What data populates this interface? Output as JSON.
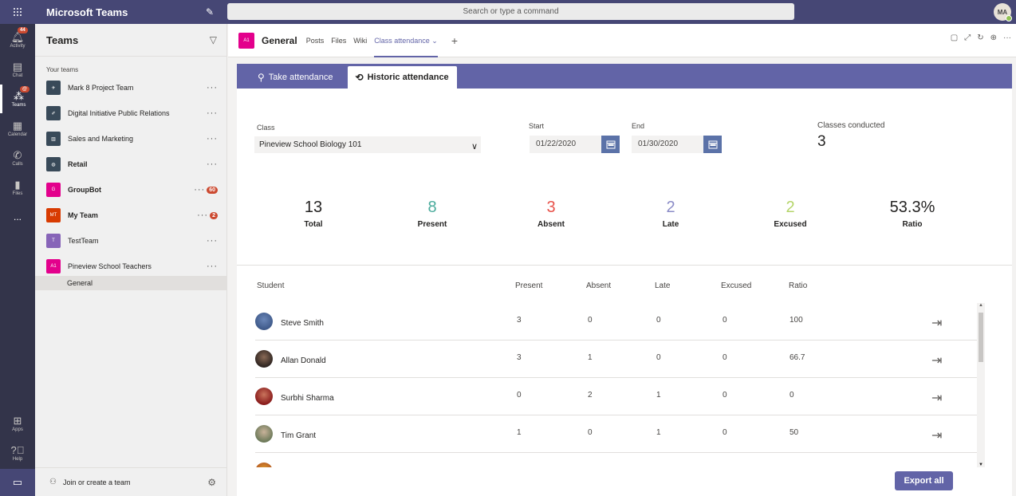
{
  "app": {
    "title": "Microsoft Teams",
    "search_placeholder": "Search or type a command",
    "user_initials": "MA"
  },
  "rail": [
    {
      "label": "Activity",
      "badge": "44"
    },
    {
      "label": "Chat",
      "badge": ""
    },
    {
      "label": "Teams",
      "badge": "@"
    },
    {
      "label": "Calendar",
      "badge": ""
    },
    {
      "label": "Calls",
      "badge": ""
    },
    {
      "label": "Files",
      "badge": ""
    },
    {
      "label": "...",
      "badge": ""
    },
    {
      "label": "Apps",
      "badge": ""
    },
    {
      "label": "Help",
      "badge": ""
    }
  ],
  "teams_panel": {
    "title": "Teams",
    "section": "Your teams",
    "teams": [
      {
        "name": "Mark 8 Project Team",
        "tile": "",
        "color": "#394a59",
        "bold": false,
        "badge": ""
      },
      {
        "name": "Digital Initiative Public Relations",
        "tile": "",
        "color": "#394a59",
        "bold": false,
        "badge": ""
      },
      {
        "name": "Sales and Marketing",
        "tile": "",
        "color": "#394a59",
        "bold": false,
        "badge": ""
      },
      {
        "name": "Retail",
        "tile": "",
        "color": "#394a59",
        "bold": true,
        "badge": ""
      },
      {
        "name": "GroupBot",
        "tile": "G",
        "color": "#e3008c",
        "bold": true,
        "badge": "60"
      },
      {
        "name": "My Team",
        "tile": "MT",
        "color": "#d83b01",
        "bold": true,
        "badge": "2"
      },
      {
        "name": "TestTeam",
        "tile": "T",
        "color": "#8764b8",
        "bold": false,
        "badge": ""
      },
      {
        "name": "Pineview School Teachers",
        "tile": "A1",
        "color": "#e3008c",
        "bold": false,
        "badge": ""
      }
    ],
    "channel": "General",
    "join_label": "Join or create a team"
  },
  "channel_bar": {
    "tile": "A1",
    "name": "General",
    "tabs": [
      "Posts",
      "Files",
      "Wiki",
      "Class attendance"
    ]
  },
  "attendance": {
    "tabs": [
      "Take attendance",
      "Historic attendance"
    ],
    "class_label": "Class",
    "class_value": "Pineview School Biology 101",
    "start_label": "Start",
    "start_value": "01/22/2020",
    "end_label": "End",
    "end_value": "01/30/2020",
    "conducted_label": "Classes conducted",
    "conducted_value": "3",
    "stats": [
      {
        "value": "13",
        "label": "Total",
        "color": "#252423"
      },
      {
        "value": "8",
        "label": "Present",
        "color": "#4aab9c"
      },
      {
        "value": "3",
        "label": "Absent",
        "color": "#e8524a"
      },
      {
        "value": "2",
        "label": "Late",
        "color": "#8b8cc7"
      },
      {
        "value": "2",
        "label": "Excused",
        "color": "#b5d56a"
      },
      {
        "value": "53.3%",
        "label": "Ratio",
        "color": "#252423"
      }
    ],
    "columns": [
      "Student",
      "Present",
      "Absent",
      "Late",
      "Excused",
      "Ratio"
    ],
    "rows": [
      {
        "name": "Steve Smith",
        "present": "3",
        "absent": "0",
        "late": "0",
        "excused": "0",
        "ratio": "100"
      },
      {
        "name": "Allan Donald",
        "present": "3",
        "absent": "1",
        "late": "0",
        "excused": "0",
        "ratio": "66.7"
      },
      {
        "name": "Surbhi Sharma",
        "present": "0",
        "absent": "2",
        "late": "1",
        "excused": "0",
        "ratio": "0"
      },
      {
        "name": "Tim Grant",
        "present": "1",
        "absent": "0",
        "late": "1",
        "excused": "0",
        "ratio": "50"
      }
    ],
    "export_label": "Export all"
  }
}
